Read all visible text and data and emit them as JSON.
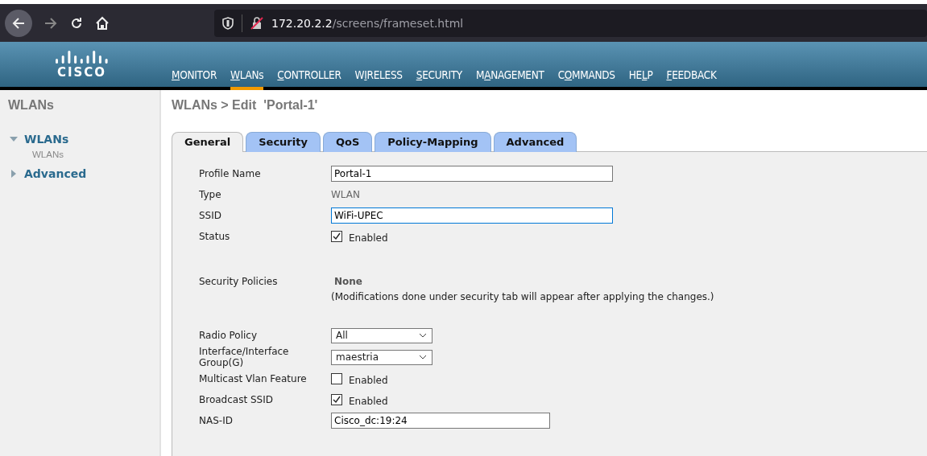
{
  "browser": {
    "url_host": "172.20.2.2",
    "url_path": "/screens/frameset.html"
  },
  "header": {
    "logo": "CISCO",
    "nav": [
      {
        "key": "M",
        "rest": "ONITOR",
        "selected": false
      },
      {
        "key": "W",
        "rest": "LANs",
        "selected": true
      },
      {
        "key": "C",
        "rest": "ONTROLLER",
        "selected": false
      },
      {
        "pre": "W",
        "key": "I",
        "rest": "RELESS",
        "selected": false
      },
      {
        "key": "S",
        "rest": "ECURITY",
        "selected": false
      },
      {
        "pre": "M",
        "key": "A",
        "rest": "NAGEMENT",
        "selected": false
      },
      {
        "pre": "C",
        "key": "O",
        "rest": "MMANDS",
        "selected": false
      },
      {
        "pre": "HE",
        "key": "L",
        "rest": "P",
        "selected": false
      },
      {
        "key": "F",
        "rest": "EEDBACK",
        "selected": false
      }
    ]
  },
  "sidebar": {
    "title": "WLANs",
    "items": [
      {
        "label": "WLANs",
        "expanded": true,
        "children": [
          {
            "label": "WLANs"
          }
        ]
      },
      {
        "label": "Advanced",
        "expanded": false
      }
    ]
  },
  "page": {
    "title": "WLANs > Edit  'Portal-1'",
    "tabs": [
      {
        "label": "General",
        "selected": true
      },
      {
        "label": "Security",
        "selected": false
      },
      {
        "label": "QoS",
        "selected": false
      },
      {
        "label": "Policy-Mapping",
        "selected": false
      },
      {
        "label": "Advanced",
        "selected": false
      }
    ],
    "fields": [
      {
        "kind": "text",
        "label": "Profile Name",
        "value": "Portal-1",
        "focused": false
      },
      {
        "kind": "static",
        "label": "Type",
        "value": "WLAN"
      },
      {
        "kind": "text",
        "label": "SSID",
        "value": "WiFi-UPEC",
        "focused": true
      },
      {
        "kind": "checkbox",
        "label": "Status",
        "checked": true,
        "text": "Enabled"
      },
      {
        "kind": "spacer"
      },
      {
        "kind": "policy",
        "label": "Security Policies",
        "value": "None",
        "note": "(Modifications done under security tab will appear after applying the changes.)"
      },
      {
        "kind": "spacer"
      },
      {
        "kind": "select",
        "label": "Radio Policy",
        "value": "All"
      },
      {
        "kind": "select",
        "label": "Interface/Interface Group(G)",
        "value": "maestria"
      },
      {
        "kind": "checkbox",
        "label": "Multicast Vlan Feature",
        "checked": false,
        "text": "Enabled"
      },
      {
        "kind": "checkbox",
        "label": "Broadcast SSID",
        "checked": true,
        "text": "Enabled"
      },
      {
        "kind": "short_text",
        "label": "NAS-ID",
        "value": "Cisco_dc:19:24",
        "focused": false
      }
    ]
  }
}
